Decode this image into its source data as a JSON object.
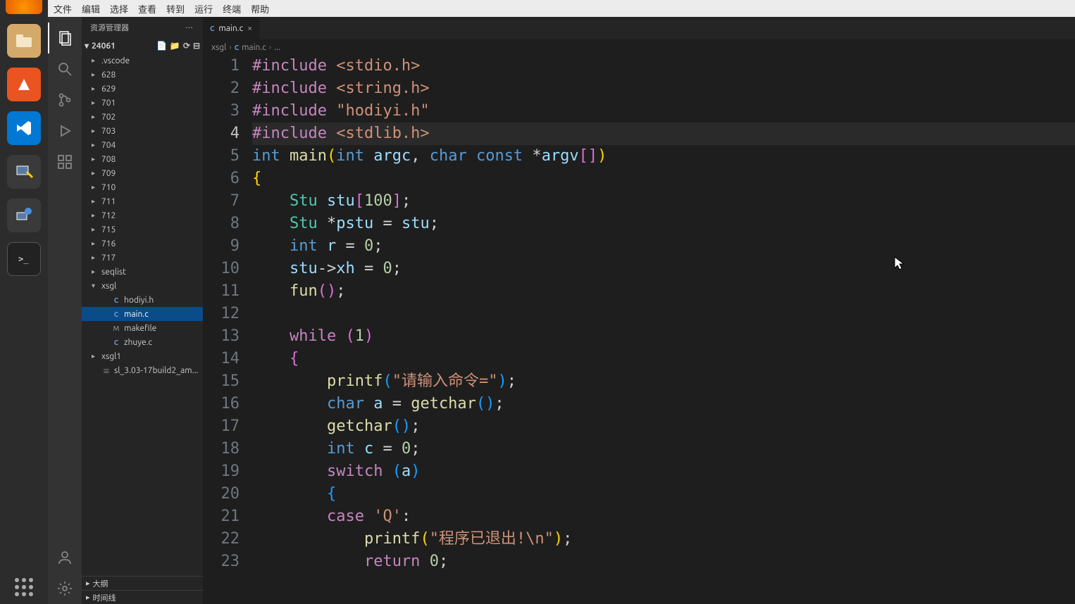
{
  "menu": {
    "file": "文件",
    "edit": "编辑",
    "select": "选择",
    "view": "查看",
    "go": "转到",
    "run": "运行",
    "terminal": "终端",
    "help": "帮助"
  },
  "sidebar": {
    "title": "资源管理器",
    "project": "24061",
    "items": [
      {
        "kind": "folder",
        "label": ".vscode"
      },
      {
        "kind": "folder",
        "label": "628"
      },
      {
        "kind": "folder",
        "label": "629"
      },
      {
        "kind": "folder",
        "label": "701"
      },
      {
        "kind": "folder",
        "label": "702"
      },
      {
        "kind": "folder",
        "label": "703"
      },
      {
        "kind": "folder",
        "label": "704"
      },
      {
        "kind": "folder",
        "label": "708"
      },
      {
        "kind": "folder",
        "label": "709"
      },
      {
        "kind": "folder",
        "label": "710"
      },
      {
        "kind": "folder",
        "label": "711"
      },
      {
        "kind": "folder",
        "label": "712"
      },
      {
        "kind": "folder",
        "label": "715"
      },
      {
        "kind": "folder",
        "label": "716"
      },
      {
        "kind": "folder",
        "label": "717"
      },
      {
        "kind": "folder",
        "label": "seqlist"
      },
      {
        "kind": "folder",
        "label": "xsgl",
        "expanded": true
      },
      {
        "kind": "file-c",
        "label": "hodiyi.h",
        "depth": 2
      },
      {
        "kind": "file-c",
        "label": "main.c",
        "depth": 2,
        "selected": true
      },
      {
        "kind": "file-m",
        "label": "makefile",
        "depth": 2
      },
      {
        "kind": "file-c",
        "label": "zhuye.c",
        "depth": 2
      },
      {
        "kind": "folder",
        "label": "xsgl1"
      },
      {
        "kind": "file-e",
        "label": "sl_3.03-17build2_am..."
      }
    ],
    "footer1": "大纲",
    "footer2": "时间线"
  },
  "tab": {
    "label": "main.c"
  },
  "breadcrumb": {
    "part1": "xsgl",
    "part2": "main.c",
    "part3": "..."
  },
  "code": {
    "lines": [
      [
        {
          "t": "keyword",
          "v": "#include"
        },
        {
          "t": "punct",
          "v": " "
        },
        {
          "t": "str",
          "v": "<stdio.h>"
        }
      ],
      [
        {
          "t": "keyword",
          "v": "#include"
        },
        {
          "t": "punct",
          "v": " "
        },
        {
          "t": "str",
          "v": "<string.h>"
        }
      ],
      [
        {
          "t": "keyword",
          "v": "#include"
        },
        {
          "t": "punct",
          "v": " "
        },
        {
          "t": "str",
          "v": "\"hodiyi.h\""
        }
      ],
      [
        {
          "t": "keyword",
          "v": "#include"
        },
        {
          "t": "punct",
          "v": " "
        },
        {
          "t": "str",
          "v": "<stdlib.h>"
        }
      ],
      [
        {
          "t": "type",
          "v": "int"
        },
        {
          "t": "punct",
          "v": " "
        },
        {
          "t": "func",
          "v": "main"
        },
        {
          "t": "paren",
          "v": "("
        },
        {
          "t": "type",
          "v": "int"
        },
        {
          "t": "punct",
          "v": " "
        },
        {
          "t": "var",
          "v": "argc"
        },
        {
          "t": "punct",
          "v": ", "
        },
        {
          "t": "type",
          "v": "char"
        },
        {
          "t": "punct",
          "v": " "
        },
        {
          "t": "type",
          "v": "const"
        },
        {
          "t": "punct",
          "v": " *"
        },
        {
          "t": "var",
          "v": "argv"
        },
        {
          "t": "brace",
          "v": "[]"
        },
        {
          "t": "paren",
          "v": ")"
        }
      ],
      [
        {
          "t": "paren",
          "v": "{"
        }
      ],
      [
        {
          "t": "punct",
          "v": "    "
        },
        {
          "t": "type2",
          "v": "Stu"
        },
        {
          "t": "punct",
          "v": " "
        },
        {
          "t": "var",
          "v": "stu"
        },
        {
          "t": "brace",
          "v": "["
        },
        {
          "t": "num",
          "v": "100"
        },
        {
          "t": "brace",
          "v": "]"
        },
        {
          "t": "punct",
          "v": ";"
        }
      ],
      [
        {
          "t": "punct",
          "v": "    "
        },
        {
          "t": "type2",
          "v": "Stu"
        },
        {
          "t": "punct",
          "v": " *"
        },
        {
          "t": "var",
          "v": "pstu"
        },
        {
          "t": "punct",
          "v": " = "
        },
        {
          "t": "var",
          "v": "stu"
        },
        {
          "t": "punct",
          "v": ";"
        }
      ],
      [
        {
          "t": "punct",
          "v": "    "
        },
        {
          "t": "type",
          "v": "int"
        },
        {
          "t": "punct",
          "v": " "
        },
        {
          "t": "var",
          "v": "r"
        },
        {
          "t": "punct",
          "v": " = "
        },
        {
          "t": "num",
          "v": "0"
        },
        {
          "t": "punct",
          "v": ";"
        }
      ],
      [
        {
          "t": "punct",
          "v": "    "
        },
        {
          "t": "var",
          "v": "stu"
        },
        {
          "t": "punct",
          "v": "->"
        },
        {
          "t": "var",
          "v": "xh"
        },
        {
          "t": "punct",
          "v": " = "
        },
        {
          "t": "num",
          "v": "0"
        },
        {
          "t": "punct",
          "v": ";"
        }
      ],
      [
        {
          "t": "punct",
          "v": "    "
        },
        {
          "t": "func",
          "v": "fun"
        },
        {
          "t": "brace",
          "v": "()"
        },
        {
          "t": "punct",
          "v": ";"
        }
      ],
      [],
      [
        {
          "t": "punct",
          "v": "    "
        },
        {
          "t": "keyword",
          "v": "while"
        },
        {
          "t": "punct",
          "v": " "
        },
        {
          "t": "brace",
          "v": "("
        },
        {
          "t": "num",
          "v": "1"
        },
        {
          "t": "brace",
          "v": ")"
        }
      ],
      [
        {
          "t": "punct",
          "v": "    "
        },
        {
          "t": "brace",
          "v": "{"
        }
      ],
      [
        {
          "t": "punct",
          "v": "        "
        },
        {
          "t": "func",
          "v": "printf"
        },
        {
          "t": "brace2",
          "v": "("
        },
        {
          "t": "str",
          "v": "\"请输入命令=\""
        },
        {
          "t": "brace2",
          "v": ")"
        },
        {
          "t": "punct",
          "v": ";"
        }
      ],
      [
        {
          "t": "punct",
          "v": "        "
        },
        {
          "t": "type",
          "v": "char"
        },
        {
          "t": "punct",
          "v": " "
        },
        {
          "t": "var",
          "v": "a"
        },
        {
          "t": "punct",
          "v": " = "
        },
        {
          "t": "func",
          "v": "getchar"
        },
        {
          "t": "brace2",
          "v": "()"
        },
        {
          "t": "punct",
          "v": ";"
        }
      ],
      [
        {
          "t": "punct",
          "v": "        "
        },
        {
          "t": "func",
          "v": "getchar"
        },
        {
          "t": "brace2",
          "v": "()"
        },
        {
          "t": "punct",
          "v": ";"
        }
      ],
      [
        {
          "t": "punct",
          "v": "        "
        },
        {
          "t": "type",
          "v": "int"
        },
        {
          "t": "punct",
          "v": " "
        },
        {
          "t": "var",
          "v": "c"
        },
        {
          "t": "punct",
          "v": " = "
        },
        {
          "t": "num",
          "v": "0"
        },
        {
          "t": "punct",
          "v": ";"
        }
      ],
      [
        {
          "t": "punct",
          "v": "        "
        },
        {
          "t": "keyword",
          "v": "switch"
        },
        {
          "t": "punct",
          "v": " "
        },
        {
          "t": "brace2",
          "v": "("
        },
        {
          "t": "var",
          "v": "a"
        },
        {
          "t": "brace2",
          "v": ")"
        }
      ],
      [
        {
          "t": "punct",
          "v": "        "
        },
        {
          "t": "brace2",
          "v": "{"
        }
      ],
      [
        {
          "t": "punct",
          "v": "        "
        },
        {
          "t": "keyword",
          "v": "case"
        },
        {
          "t": "punct",
          "v": " "
        },
        {
          "t": "str",
          "v": "'Q'"
        },
        {
          "t": "punct",
          "v": ":"
        }
      ],
      [
        {
          "t": "punct",
          "v": "            "
        },
        {
          "t": "func",
          "v": "printf"
        },
        {
          "t": "paren",
          "v": "("
        },
        {
          "t": "str",
          "v": "\"程序已退出!\\n\""
        },
        {
          "t": "paren",
          "v": ")"
        },
        {
          "t": "punct",
          "v": ";"
        }
      ],
      [
        {
          "t": "punct",
          "v": "            "
        },
        {
          "t": "keyword",
          "v": "return"
        },
        {
          "t": "punct",
          "v": " "
        },
        {
          "t": "num",
          "v": "0"
        },
        {
          "t": "punct",
          "v": ";"
        }
      ]
    ],
    "current_line": 4
  }
}
